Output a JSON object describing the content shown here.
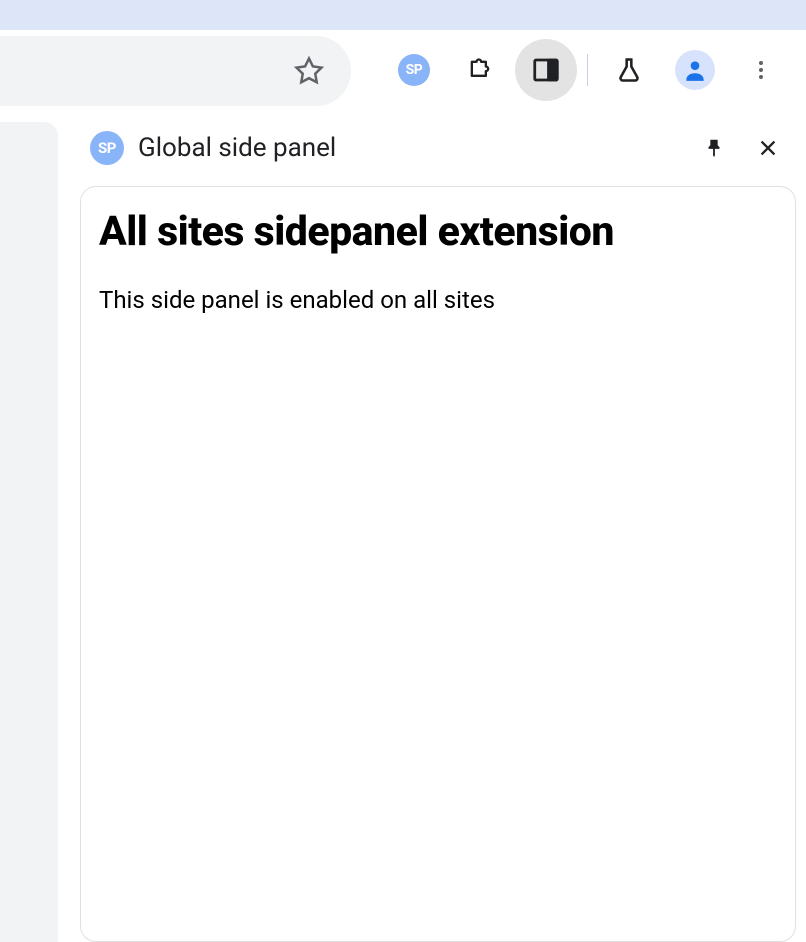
{
  "toolbar": {
    "extension_badge": "SP"
  },
  "side_panel": {
    "header": {
      "badge": "SP",
      "title": "Global side panel"
    },
    "content": {
      "heading": "All sites sidepanel extension",
      "description": "This side panel is enabled on all sites"
    }
  }
}
